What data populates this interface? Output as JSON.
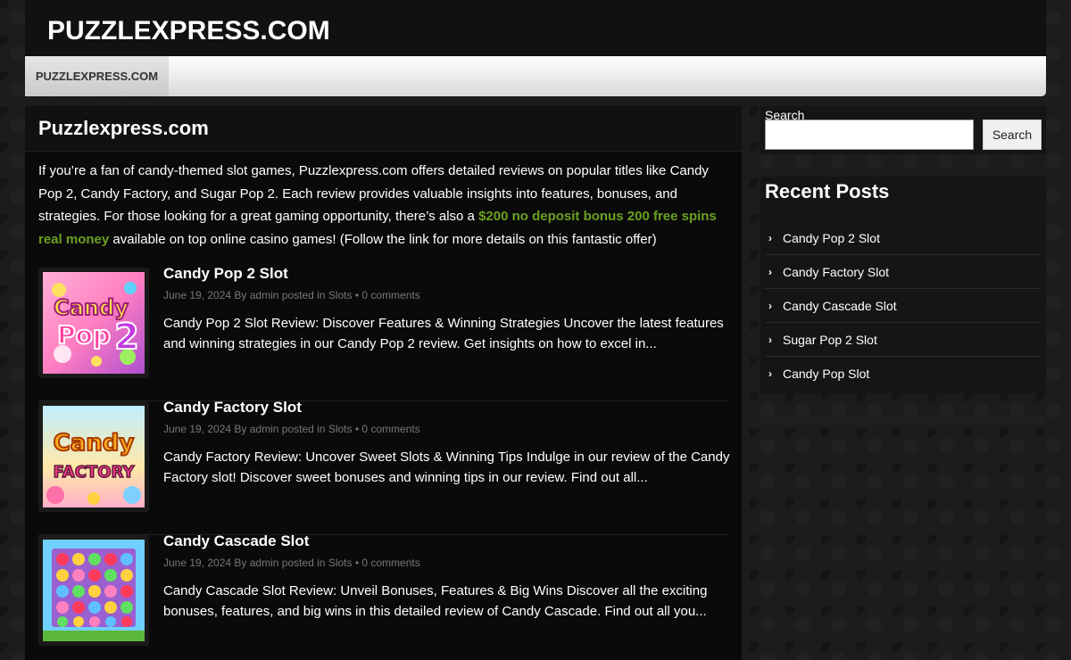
{
  "site": {
    "title": "PUZZLEXPRESS.COM"
  },
  "nav": {
    "items": [
      {
        "label": "PUZZLEXPRESS.COM"
      }
    ]
  },
  "main": {
    "page_title": "Puzzlexpress.com",
    "intro_before": "If you’re a fan of candy-themed slot games, Puzzlexpress.com offers detailed reviews on popular titles like Candy Pop 2, Candy Factory, and Sugar Pop 2. Each review provides valuable insights into features, bonuses, and strategies. For those looking for a great gaming opportunity, there’s also a ",
    "intro_link": "$200 no deposit bonus 200 free spins real money",
    "intro_after": " available on top online casino games! (Follow the link for more details on this fantastic offer)",
    "link_color": "#6aa121",
    "posts": [
      {
        "title": "Candy Pop 2 Slot",
        "date": "June 19, 2024",
        "by": " By ",
        "author": "admin",
        "posted_in": " posted in ",
        "category": "Slots",
        "sep": " • ",
        "comments": "0 comments",
        "excerpt": "Candy Pop 2 Slot Review: Discover Features & Winning Strategies Uncover the latest features and winning strategies in our Candy Pop 2 review. Get insights on how to excel in...",
        "thumb_text_1": "Candy",
        "thumb_text_2": "Pop",
        "thumb_text_3": "2"
      },
      {
        "title": "Candy Factory Slot",
        "date": "June 19, 2024",
        "by": " By ",
        "author": "admin",
        "posted_in": " posted in ",
        "category": "Slots",
        "sep": " • ",
        "comments": "0 comments",
        "excerpt": "Candy Factory Review: Uncover Sweet Slots & Winning Tips Indulge in our review of the Candy Factory slot! Discover sweet bonuses and winning tips in our review. Find out all...",
        "thumb_text_1": "Candy",
        "thumb_text_2": "FACTORY"
      },
      {
        "title": "Candy Cascade Slot",
        "date": "June 19, 2024",
        "by": " By ",
        "author": "admin",
        "posted_in": " posted in ",
        "category": "Slots",
        "sep": " • ",
        "comments": "0 comments",
        "excerpt": "Candy Cascade Slot Review: Unveil Bonuses, Features & Big Wins Discover all the exciting bonuses, features, and big wins in this detailed review of Candy Cascade. Find out all you..."
      }
    ]
  },
  "sidebar": {
    "search_label": "Search",
    "search_placeholder": "",
    "search_button": "Search",
    "recent_title": "Recent Posts",
    "recent_posts": [
      "Candy Pop 2 Slot",
      "Candy Factory Slot",
      "Candy Cascade Slot",
      "Sugar Pop 2 Slot",
      "Candy Pop Slot"
    ],
    "chevron": "›"
  }
}
